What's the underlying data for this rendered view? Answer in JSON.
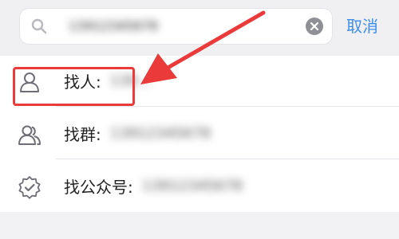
{
  "search": {
    "value": "13912345678",
    "cancel_label": "取消"
  },
  "results": [
    {
      "label": "找人:",
      "value": "139…",
      "icon": "person-icon"
    },
    {
      "label": "找群:",
      "value": "13912345678",
      "icon": "group-icon"
    },
    {
      "label": "找公众号:",
      "value": "13912345678",
      "icon": "official-account-icon"
    }
  ],
  "colors": {
    "accent": "#3b8eea",
    "highlight": "#ea3a3a",
    "icon": "#6e6e76"
  }
}
